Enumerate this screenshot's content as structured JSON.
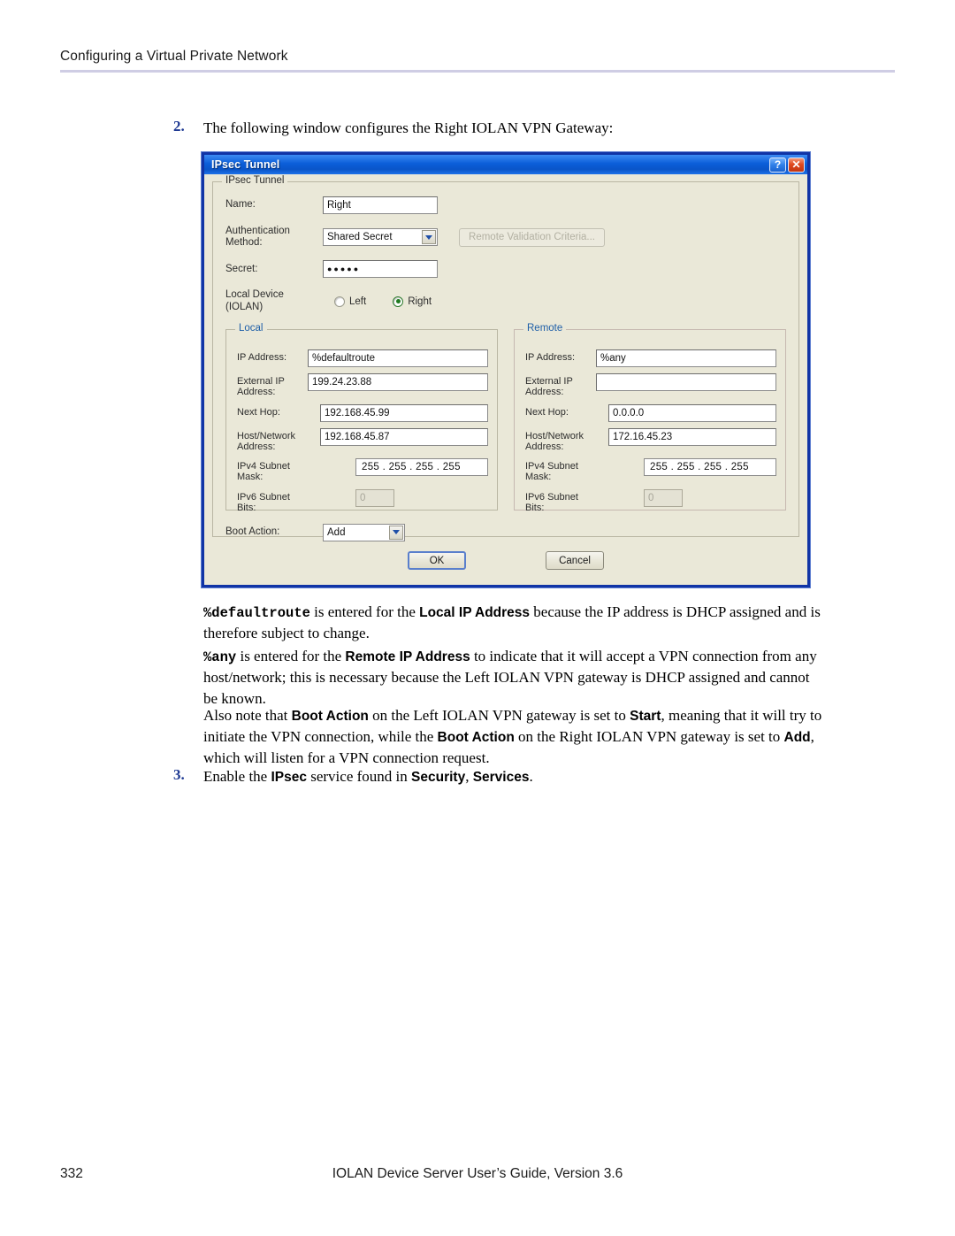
{
  "header": {
    "title": "Configuring a Virtual Private Network"
  },
  "steps": {
    "two": {
      "num": "2.",
      "text": "The following window configures the Right IOLAN VPN Gateway:"
    },
    "three": {
      "num": "3.",
      "prefix": "Enable the ",
      "bold1": "IPsec",
      "mid": " service found in ",
      "bold2": "Security",
      "mid2": ", ",
      "bold3": "Services",
      "suffix": "."
    }
  },
  "dialog": {
    "window_title": "IPsec Tunnel",
    "help_button": "?",
    "close_button": "✕",
    "group_legend": "IPsec Tunnel",
    "name_label": "Name:",
    "name_value": "Right",
    "auth_label": "Authentication Method:",
    "auth_value": "Shared Secret",
    "remote_validation_button": "Remote Validation Criteria...",
    "secret_label": "Secret:",
    "secret_value": "●●●●●",
    "local_device_label": "Local Device (IOLAN)",
    "radio_left": "Left",
    "radio_right": "Right",
    "selected_device": "Right",
    "boot_action_label": "Boot Action:",
    "boot_action_value": "Add",
    "ok_button": "OK",
    "cancel_button": "Cancel",
    "local": {
      "legend": "Local",
      "ip_address_label": "IP Address:",
      "ip_address_value": "%defaultroute",
      "external_ip_label": "External IP Address:",
      "external_ip_value": "199.24.23.88",
      "next_hop_label": "Next Hop:",
      "next_hop_value": "192.168.45.99",
      "host_network_label": "Host/Network Address:",
      "host_network_value": "192.168.45.87",
      "ipv4_mask_label": "IPv4 Subnet Mask:",
      "ipv4_mask_value": "255  .  255  .  255  .  255",
      "ipv6_bits_label": "IPv6 Subnet Bits:",
      "ipv6_bits_value": "0"
    },
    "remote": {
      "legend": "Remote",
      "ip_address_label": "IP Address:",
      "ip_address_value": "%any",
      "external_ip_label": "External IP Address:",
      "external_ip_value": "",
      "next_hop_label": "Next Hop:",
      "next_hop_value": "0.0.0.0",
      "host_network_label": "Host/Network Address:",
      "host_network_value": "172.16.45.23",
      "ipv4_mask_label": "IPv4 Subnet Mask:",
      "ipv4_mask_value": "255  .  255  .  255  .  255",
      "ipv6_bits_label": "IPv6 Subnet Bits:",
      "ipv6_bits_value": "0"
    }
  },
  "paragraphs": {
    "p1": {
      "mono1": "%defaultroute",
      "t1": " is entered for the ",
      "b1": "Local IP Address",
      "t2": " because the IP address is DHCP assigned and is therefore subject to change."
    },
    "p2": {
      "mono1": "%any",
      "t1": " is entered for the ",
      "b1": "Remote IP Address",
      "t2": " to indicate that it will accept a VPN connection from any host/network; this is necessary because the Left IOLAN VPN gateway is DHCP assigned and cannot be known."
    },
    "p3": {
      "t1": "Also note that ",
      "b1": "Boot Action",
      "t2": " on the Left IOLAN VPN gateway is set to ",
      "b2": "Start",
      "t3": ", meaning that it will try to initiate the VPN connection, while the ",
      "b3": "Boot Action",
      "t4": " on the Right IOLAN VPN gateway is set to ",
      "b4": "Add",
      "t5": ", which will listen for a VPN connection request."
    }
  },
  "footer": {
    "page_number": "332",
    "guide_title": "IOLAN Device Server User’s Guide, Version 3.6"
  }
}
